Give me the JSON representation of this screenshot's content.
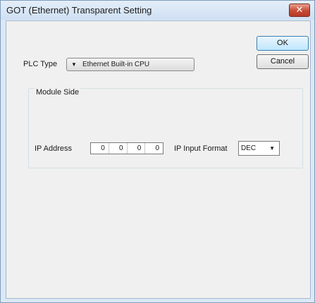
{
  "window": {
    "title": "GOT (Ethernet) Transparent Setting",
    "close_glyph": "✕"
  },
  "buttons": {
    "ok": "OK",
    "cancel": "Cancel"
  },
  "plc_type": {
    "label": "PLC Type",
    "value": "Ethernet Built-in CPU",
    "arrow": "▼"
  },
  "module_side": {
    "title": "Module Side",
    "ip_label": "IP Address",
    "ip_octets": [
      "0",
      "0",
      "0",
      "0"
    ],
    "format_label": "IP Input Format",
    "format_value": "DEC",
    "format_arrow": "▼"
  }
}
